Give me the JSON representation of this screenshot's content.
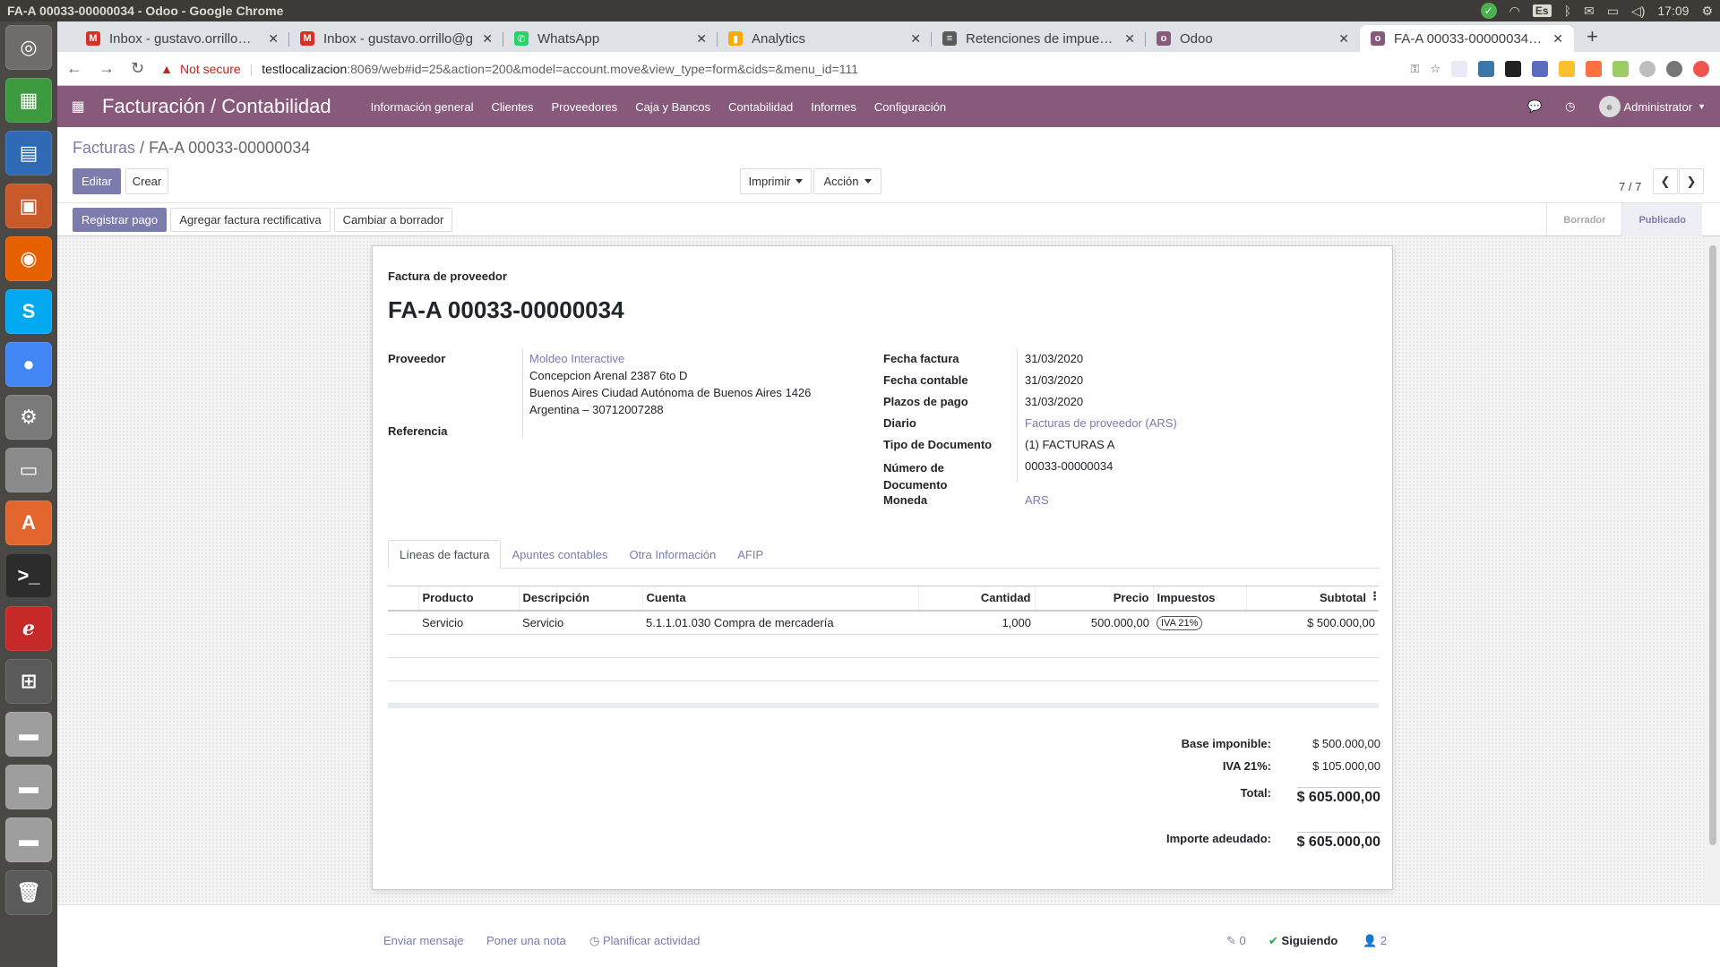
{
  "os": {
    "window_title": "FA-A 00033-00000034 - Odoo - Google Chrome",
    "keyboard_layout": "Es",
    "clock": "17:09"
  },
  "launcher": {
    "items": [
      {
        "name": "ubuntu-dash-icon",
        "glyph": "◎",
        "color": "#6f6d69"
      },
      {
        "name": "spreadsheet-icon",
        "glyph": "▦",
        "color": "#3e9a3e"
      },
      {
        "name": "writer-icon",
        "glyph": "▤",
        "color": "#2e6ab5"
      },
      {
        "name": "impress-icon",
        "glyph": "▣",
        "color": "#c9582b"
      },
      {
        "name": "firefox-icon",
        "glyph": "◉",
        "color": "#e66000"
      },
      {
        "name": "skype-icon",
        "glyph": "S",
        "color": "#00a9f0"
      },
      {
        "name": "chrome-icon",
        "glyph": "●",
        "color": "#4285f4"
      },
      {
        "name": "system-settings-icon",
        "glyph": "⚙",
        "color": "#7a7a7a"
      },
      {
        "name": "file-manager-icon",
        "glyph": "▭",
        "color": "#8a8a8a"
      },
      {
        "name": "software-center-icon",
        "glyph": "A",
        "color": "#e2662e"
      },
      {
        "name": "terminal-icon",
        "glyph": ">_",
        "color": "#2c2c2c"
      },
      {
        "name": "foxit-reader-icon",
        "glyph": "ℯ",
        "color": "#c62828"
      },
      {
        "name": "workspace-switcher-icon",
        "glyph": "⊞",
        "color": "#5a5a5a"
      },
      {
        "name": "disk-drive-icon",
        "glyph": "▬",
        "color": "#9e9e9e"
      },
      {
        "name": "disk-drive-icon",
        "glyph": "▬",
        "color": "#9e9e9e"
      },
      {
        "name": "disk-drive-icon",
        "glyph": "▬",
        "color": "#9e9e9e"
      },
      {
        "name": "trash-icon",
        "glyph": "🗑",
        "color": "#5a5a5a"
      }
    ]
  },
  "browser": {
    "tabs": [
      {
        "label": "Inbox - gustavo.orrillo@m",
        "favicon": "M",
        "fav_color": "#d93025",
        "active": false
      },
      {
        "label": "Inbox - gustavo.orrillo@g",
        "favicon": "M",
        "fav_color": "#d93025",
        "active": false
      },
      {
        "label": "WhatsApp",
        "favicon": "✆",
        "fav_color": "#25d366",
        "active": false
      },
      {
        "label": "Analytics",
        "favicon": "▮",
        "fav_color": "#f9ab00",
        "active": false
      },
      {
        "label": "Retenciones de impuestos",
        "favicon": "≡",
        "fav_color": "#5b5b5b",
        "active": false
      },
      {
        "label": "Odoo",
        "favicon": "o",
        "fav_color": "#875a7b",
        "active": false
      },
      {
        "label": "FA-A 00033-00000034 - Odoo",
        "favicon": "o",
        "fav_color": "#875a7b",
        "active": true
      }
    ],
    "security_warning": "Not secure",
    "url_host": "testlocalizacion",
    "url_rest": ":8069/web#id=25&action=200&model=account.move&view_type=form&cids=&menu_id=111"
  },
  "odoo_nav": {
    "brand": "Facturación / Contabilidad",
    "menus": [
      "Información general",
      "Clientes",
      "Proveedores",
      "Caja y Bancos",
      "Contabilidad",
      "Informes",
      "Configuración"
    ],
    "user": "Administrator",
    "accent": "#875a7b"
  },
  "control_panel": {
    "breadcrumb_parent": "Facturas",
    "breadcrumb_sep": "/",
    "breadcrumb_current": "FA-A 00033-00000034",
    "edit": "Editar",
    "create": "Crear",
    "print": "Imprimir",
    "action": "Acción",
    "pager": "7 / 7"
  },
  "status": {
    "buttons": [
      "Registrar pago",
      "Agregar factura rectificativa",
      "Cambiar a borrador"
    ],
    "steps": [
      "Borrador",
      "Publicado"
    ],
    "current_step": "Publicado"
  },
  "invoice": {
    "type": "Factura de proveedor",
    "name": "FA-A 00033-00000034",
    "partner_label": "Proveedor",
    "partner_name": "Moldeo Interactive",
    "partner_address": [
      "Concepcion Arenal 2387 6to D",
      "Buenos Aires Ciudad Autónoma de Buenos Aires 1426",
      "Argentina – 30712007288"
    ],
    "reference_label": "Referencia",
    "fields": [
      {
        "label": "Fecha factura",
        "value": "31/03/2020"
      },
      {
        "label": "Fecha contable",
        "value": "31/03/2020"
      },
      {
        "label": "Plazos de pago",
        "value": "31/03/2020"
      },
      {
        "label": "Diario",
        "value": "Facturas de proveedor (ARS)"
      },
      {
        "label": "Tipo de Documento",
        "value": "(1) FACTURAS A"
      },
      {
        "label": "Número de Documento",
        "value": "00033-00000034"
      },
      {
        "label": "Moneda",
        "value": "ARS"
      }
    ],
    "tabs": [
      "Líneas de factura",
      "Apuntes contables",
      "Otra Información",
      "AFIP"
    ],
    "columns": [
      "Producto",
      "Descripción",
      "Cuenta",
      "Cantidad",
      "Precio",
      "Impuestos",
      "Subtotal"
    ],
    "lines": [
      {
        "product": "Servicio",
        "description": "Servicio",
        "account": "5.1.1.01.030 Compra de mercadería",
        "qty": "1,000",
        "price": "500.000,00",
        "tax": "IVA 21%",
        "subtotal": "$ 500.000,00"
      }
    ],
    "totals": [
      {
        "label": "Base imponible:",
        "value": "$ 500.000,00"
      },
      {
        "label": "IVA 21%:",
        "value": "$ 105.000,00"
      },
      {
        "label": "Total:",
        "value": "$ 605.000,00"
      },
      {
        "label": "Importe adeudado:",
        "value": "$ 605.000,00"
      }
    ]
  },
  "chatter": {
    "send_message": "Enviar mensaje",
    "log_note": "Poner una nota",
    "schedule": "Planificar actividad",
    "attachments": "0",
    "following": "Siguiendo",
    "followers": "2"
  }
}
